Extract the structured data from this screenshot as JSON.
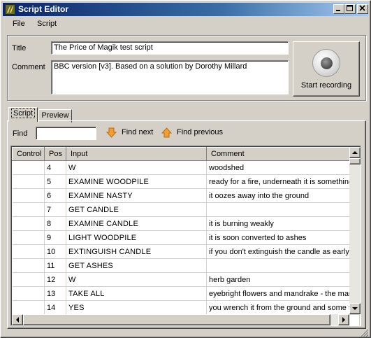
{
  "window": {
    "title": "Script Editor"
  },
  "menu": {
    "items": [
      "File",
      "Script"
    ]
  },
  "form": {
    "title_label": "Title",
    "title_value": "The Price of Magik test script",
    "comment_label": "Comment",
    "comment_value": "BBC version [v3]. Based on a solution by Dorothy Millard"
  },
  "record_button": {
    "label": "Start recording"
  },
  "tabs": [
    {
      "label": "Script",
      "active": true
    },
    {
      "label": "Preview",
      "active": false
    }
  ],
  "find": {
    "label": "Find",
    "value": "",
    "next_label": "Find next",
    "previous_label": "Find previous"
  },
  "table": {
    "headers": [
      "Control",
      "Pos",
      "Input",
      "Comment"
    ],
    "rows": [
      {
        "control": "",
        "pos": "4",
        "input": "W",
        "comment": "woodshed"
      },
      {
        "control": "",
        "pos": "5",
        "input": "EXAMINE WOODPILE",
        "comment": "ready for a fire, underneath it is something n"
      },
      {
        "control": "",
        "pos": "6",
        "input": "EXAMINE NASTY",
        "comment": "it oozes away into the ground"
      },
      {
        "control": "",
        "pos": "7",
        "input": "GET CANDLE",
        "comment": ""
      },
      {
        "control": "",
        "pos": "8",
        "input": "EXAMINE CANDLE",
        "comment": "it is burning weakly"
      },
      {
        "control": "",
        "pos": "9",
        "input": "LIGHT WOODPILE",
        "comment": "it is soon converted to ashes"
      },
      {
        "control": "",
        "pos": "10",
        "input": "EXTINGUISH CANDLE",
        "comment": "if you don't extinguish the candle as early a"
      },
      {
        "control": "",
        "pos": "11",
        "input": "GET ASHES",
        "comment": ""
      },
      {
        "control": "",
        "pos": "12",
        "input": "W",
        "comment": "herb garden"
      },
      {
        "control": "",
        "pos": "13",
        "input": "TAKE ALL",
        "comment": "eyebright flowers and mandrake - the mand"
      },
      {
        "control": "",
        "pos": "14",
        "input": "YES",
        "comment": "you wrench it from the ground and some thi"
      },
      {
        "control": "",
        "pos": "",
        "input": "",
        "comment": ""
      }
    ]
  },
  "colors": {
    "titlebar_start": "#0a246a",
    "titlebar_end": "#a6caf0",
    "face": "#d4d0c8",
    "arrow": "#f0a030"
  },
  "icons": {
    "app": "script-editor-app-icon",
    "minimize": "minimize-icon",
    "maximize": "maximize-icon",
    "close": "close-icon",
    "record": "record-icon",
    "find_next": "arrow-down-icon",
    "find_previous": "arrow-up-icon"
  }
}
